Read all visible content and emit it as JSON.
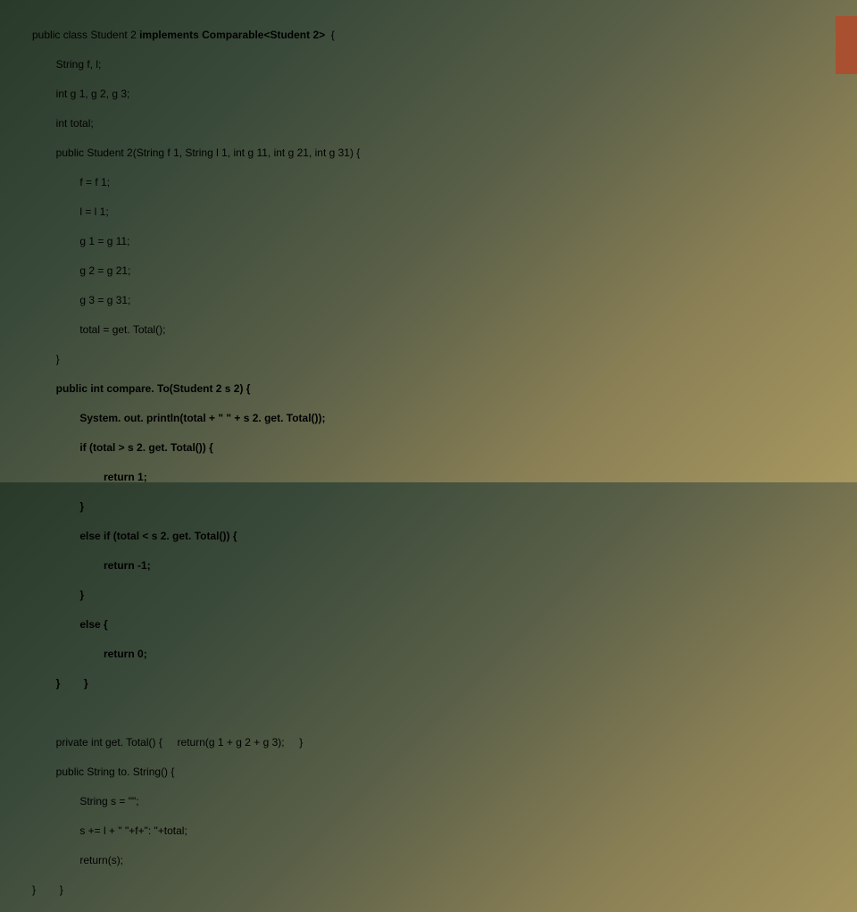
{
  "code": {
    "l1a": "public class Student 2 ",
    "l1b": "implements Comparable<Student 2> ",
    "l1c": " {",
    "l2": "String f, l;",
    "l3": "int g 1, g 2, g 3;",
    "l4": "int total;",
    "l5": "public Student 2(String f 1, String l 1, int g 11, int g 21, int g 31) {",
    "l6": "f = f 1;",
    "l7": "l = l 1;",
    "l8": "g 1 = g 11;",
    "l9": "g 2 = g 21;",
    "l10": "g 3 = g 31;",
    "l11": "total = get. Total();",
    "l12": "}",
    "l13": "public int compare. To(Student 2 s 2) {",
    "l14": "System. out. println(total + \" \" + s 2. get. Total());",
    "l15": "if (total > s 2. get. Total()) {",
    "l16": "return 1;",
    "l17": "}",
    "l18": "else if (total < s 2. get. Total()) {",
    "l19": "return -1;",
    "l20": "}",
    "l21": "else {",
    "l22": "return 0;",
    "l23": "}",
    "l24": "}",
    "l25a": "private int get. Total() {",
    "l25b": "return(g 1 + g 2 + g 3);",
    "l25c": "}",
    "l26": "public String to. String() {",
    "l27": "String s = \"\";",
    "l28": "s += l + \" \"+f+\": \"+total;",
    "l29": "return(s);",
    "l30": "}",
    "l31": "}"
  }
}
